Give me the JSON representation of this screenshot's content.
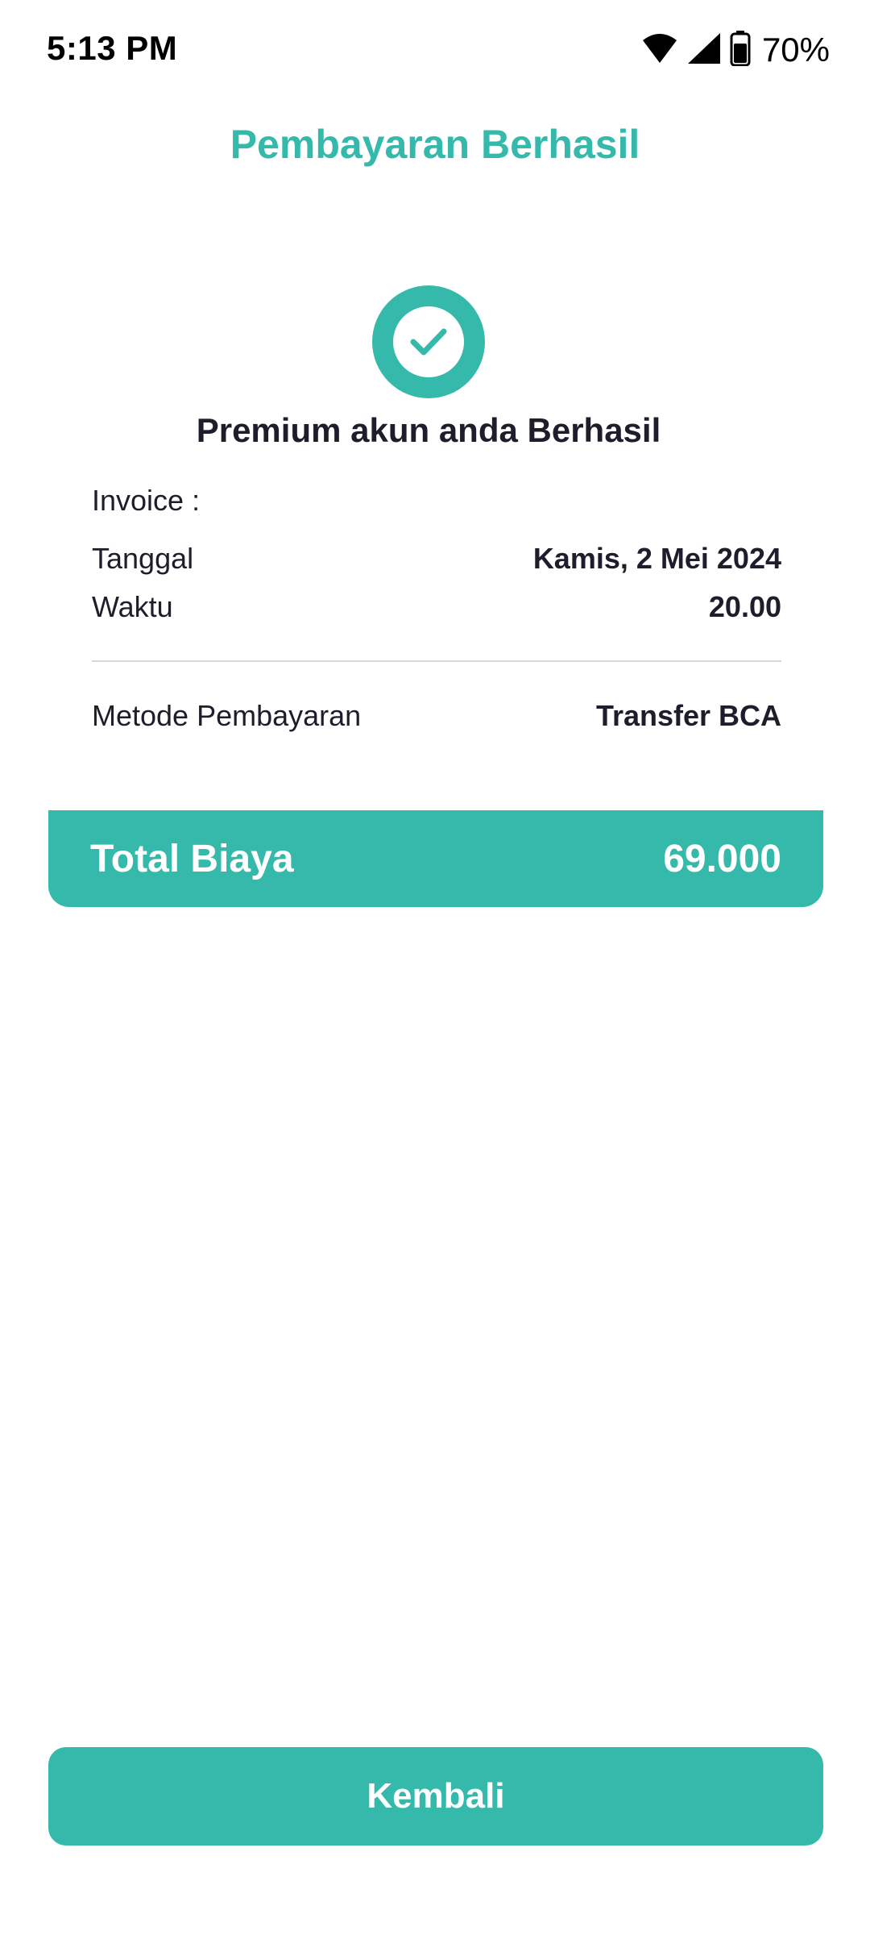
{
  "status_bar": {
    "time": "5:13 PM",
    "battery_percent": "70%",
    "icons": [
      "wifi-icon",
      "cellular-signal-icon",
      "battery-icon"
    ]
  },
  "header": {
    "title": "Pembayaran Berhasil"
  },
  "success": {
    "icon": "check-circle-icon",
    "message": "Premium akun anda Berhasil"
  },
  "details": {
    "invoice_label": "Invoice :",
    "invoice_value": "",
    "date_label": "Tanggal",
    "date_value": "Kamis, 2 Mei 2024",
    "time_label": "Waktu",
    "time_value": "20.00",
    "method_label": "Metode Pembayaran",
    "method_value": "Transfer BCA"
  },
  "total": {
    "label": "Total Biaya",
    "value": "69.000"
  },
  "actions": {
    "back_label": "Kembali"
  },
  "colors": {
    "accent": "#35b9ab",
    "text_dark": "#1f1d2b",
    "divider": "#d8d8dc"
  }
}
